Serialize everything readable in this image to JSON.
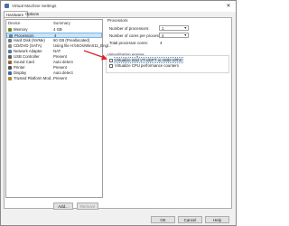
{
  "window": {
    "title": "Virtual Machine Settings"
  },
  "tabs": [
    {
      "label": "Hardware"
    },
    {
      "label": "Options"
    }
  ],
  "device_list": {
    "columns": {
      "device": "Device",
      "summary": "Summary"
    },
    "rows": [
      {
        "device": "Memory",
        "summary": "4 GB",
        "icon": "memory-icon",
        "color": "#6b8e23"
      },
      {
        "device": "Processors",
        "summary": "4",
        "icon": "processor-icon",
        "color": "#5f7fa8"
      },
      {
        "device": "Hard Disk (NVMe)",
        "summary": "60 GB (Preallocated)",
        "icon": "hard-disk-icon",
        "color": "#7a7a7a"
      },
      {
        "device": "CD/DVD (SATA)",
        "summary": "Using file H:\\ISOs\\WinX11_Engl...",
        "icon": "cd-dvd-icon",
        "color": "#8a8a8a"
      },
      {
        "device": "Network Adapter",
        "summary": "NAT",
        "icon": "network-icon",
        "color": "#4f7cab"
      },
      {
        "device": "USB Controller",
        "summary": "Present",
        "icon": "usb-icon",
        "color": "#606060"
      },
      {
        "device": "Sound Card",
        "summary": "Auto detect",
        "icon": "sound-icon",
        "color": "#8a6d3b"
      },
      {
        "device": "Printer",
        "summary": "Present",
        "icon": "printer-icon",
        "color": "#555555"
      },
      {
        "device": "Display",
        "summary": "Auto detect",
        "icon": "display-icon",
        "color": "#3a6ea5"
      },
      {
        "device": "Trusted Platform Mod...",
        "summary": "Present",
        "icon": "tpm-icon",
        "color": "#b08a2e"
      }
    ],
    "selected_index": 1
  },
  "buttons": {
    "add": "Add...",
    "remove": "Remove",
    "ok": "OK",
    "cancel": "Cancel",
    "help": "Help"
  },
  "processors": {
    "group_label": "Processors",
    "num_processors_label": "Number of processors:",
    "num_processors_value": "1",
    "cores_label": "Number of cores per processor:",
    "cores_value": "4",
    "total_label": "Total processor cores:",
    "total_value": "4"
  },
  "virtualization": {
    "group_label": "Virtualization engine",
    "option1": "Virtualize Intel VT-x/EPT or AMD-V/RVI",
    "option1_checked": false,
    "option2": "Virtualize CPU performance counters",
    "option2_checked": false
  },
  "colors": {
    "accent": "#cce4f7",
    "annotation_arrow": "#d9262b"
  }
}
